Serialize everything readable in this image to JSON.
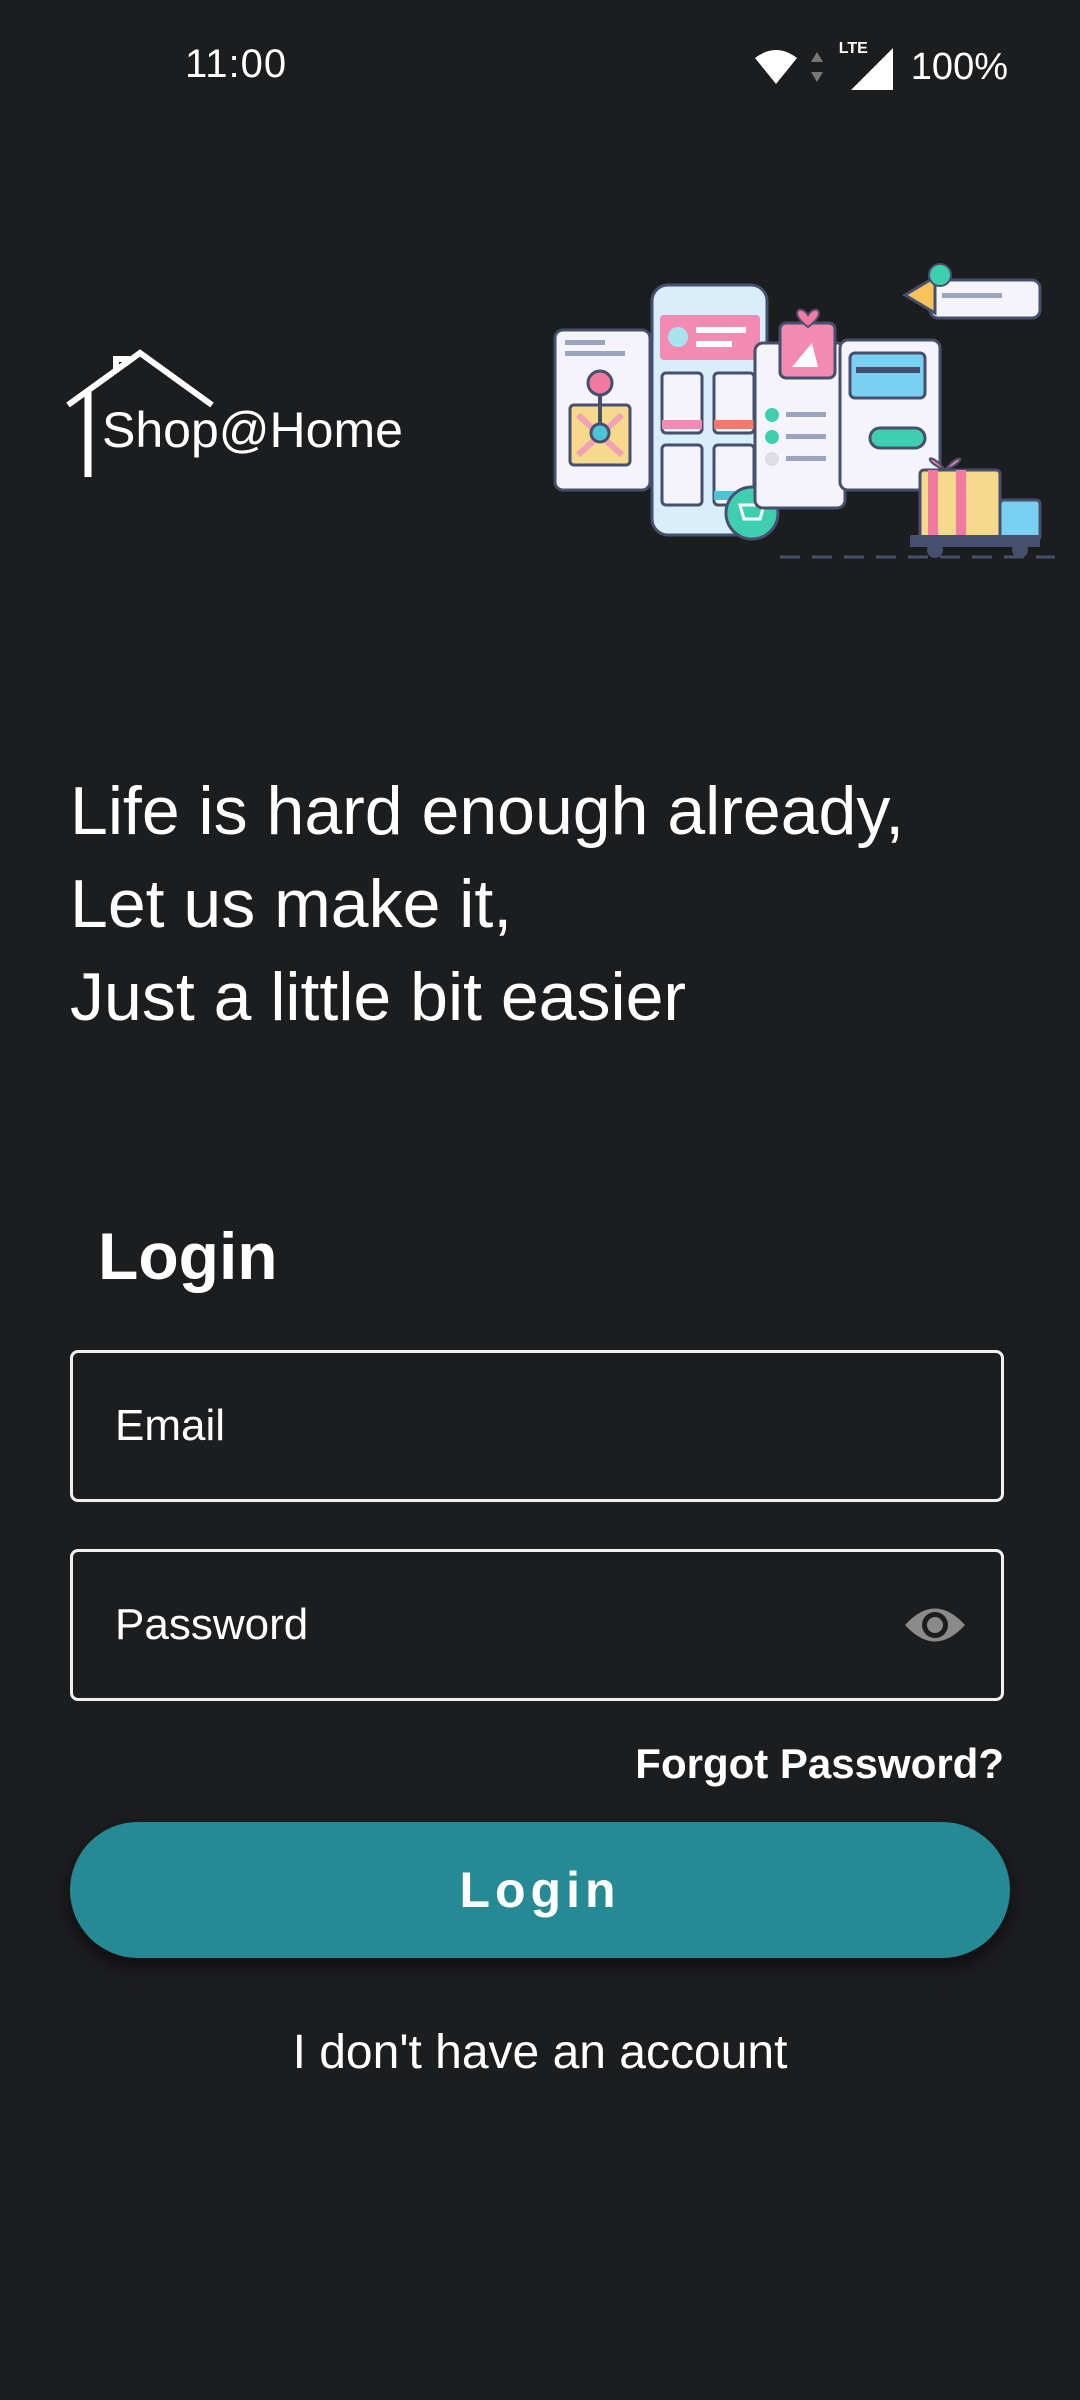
{
  "status_bar": {
    "time": "11:00",
    "network_label": "LTE",
    "battery": "100%",
    "icons": [
      "wifi-icon",
      "mobile-data-arrows-icon",
      "signal-icon"
    ]
  },
  "logo": {
    "text": "Shop@Home",
    "icon": "house-outline-icon"
  },
  "illustration": {
    "icon": "online-shopping-illustration"
  },
  "tagline": {
    "line1": "Life is hard enough already,",
    "line2": "Let us make it,",
    "line3": "Just a little bit easier"
  },
  "login_form": {
    "heading": "Login",
    "email_placeholder": "Email",
    "password_placeholder": "Password",
    "password_toggle_icon": "eye-icon",
    "forgot_password": "Forgot Password?",
    "submit_label": "Login",
    "no_account": "I don't have an account"
  },
  "colors": {
    "background": "#1c1d1f",
    "accent": "#268a94",
    "text": "#ffffff"
  }
}
